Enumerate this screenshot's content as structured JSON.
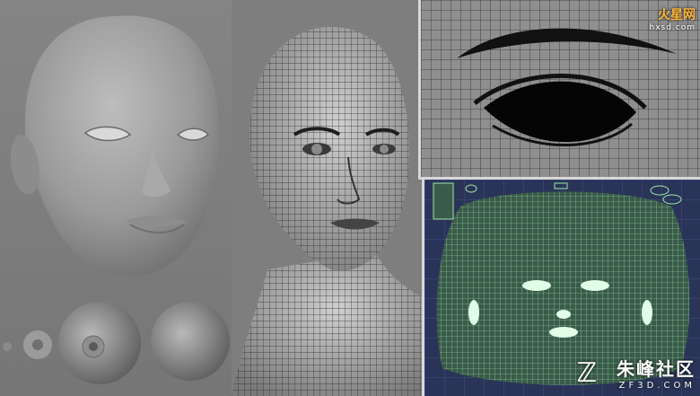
{
  "watermark_top": {
    "brand": "火星网",
    "domain": "hxsd.com"
  },
  "watermark_bottom": {
    "brand": "朱峰社区",
    "domain": "ZF3D.COM"
  },
  "colors": {
    "uv_background": "#2a3458",
    "uv_wire": "#9fe8a8",
    "wire": "#222222"
  }
}
